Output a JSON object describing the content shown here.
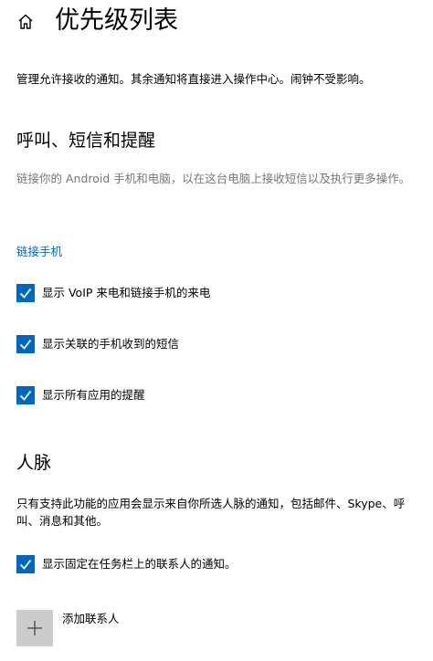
{
  "header": {
    "home_icon": "home-icon",
    "title": "优先级列表"
  },
  "intro": "管理允许接收的通知。其余通知将直接进入操作中心。闹钟不受影响。",
  "calls_section": {
    "title": "呼叫、短信和提醒",
    "description": "链接你的 Android 手机和电脑，以在这台电脑上接收短信以及执行更多操作。",
    "link_label": "链接手机",
    "checkboxes": [
      {
        "label": "显示 VoIP 来电和链接手机的来电",
        "checked": true
      },
      {
        "label": "显示关联的手机收到的短信",
        "checked": true
      },
      {
        "label": "显示所有应用的提醒",
        "checked": true
      }
    ]
  },
  "people_section": {
    "title": "人脉",
    "description": "只有支持此功能的应用会显示来自你所选人脉的通知，包括邮件、Skype、呼叫、消息和其他。",
    "checkbox": {
      "label": "显示固定在任务栏上的联系人的通知。",
      "checked": true
    },
    "add_label": "添加联系人",
    "add_icon": "plus-icon"
  },
  "colors": {
    "accent": "#0067c0",
    "tile_bg": "#cccccc",
    "muted_text": "#777777"
  }
}
